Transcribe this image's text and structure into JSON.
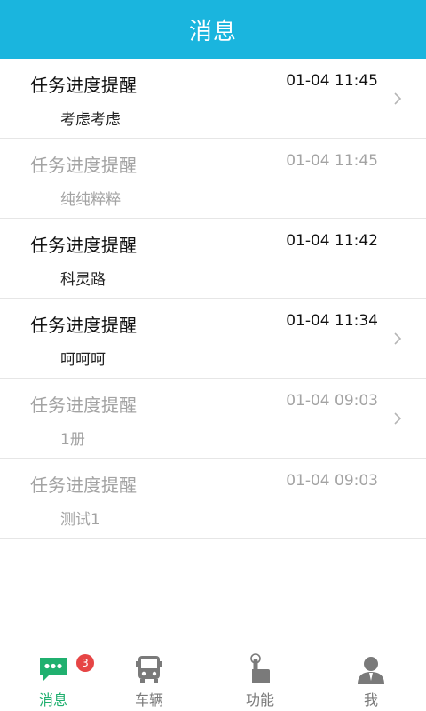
{
  "header": {
    "title": "消息"
  },
  "messages": [
    {
      "title": "任务进度提醒",
      "time": "01-04 11:45",
      "body": "考虑考虑",
      "read": false,
      "chevron": true
    },
    {
      "title": "任务进度提醒",
      "time": "01-04 11:45",
      "body": "纯纯粹粹",
      "read": true,
      "chevron": false
    },
    {
      "title": "任务进度提醒",
      "time": "01-04 11:42",
      "body": "科灵路",
      "read": false,
      "chevron": false
    },
    {
      "title": "任务进度提醒",
      "time": "01-04 11:34",
      "body": "呵呵呵",
      "read": false,
      "chevron": true
    },
    {
      "title": "任务进度提醒",
      "time": "01-04 09:03",
      "body": "1册",
      "read": true,
      "chevron": true
    },
    {
      "title": "任务进度提醒",
      "time": "01-04 09:03",
      "body": "测试1",
      "read": true,
      "chevron": false
    }
  ],
  "tabbar": {
    "tabs": [
      {
        "label": "消息",
        "icon": "chat-bubble-icon",
        "active": true,
        "badge": "3"
      },
      {
        "label": "车辆",
        "icon": "bus-icon",
        "active": false
      },
      {
        "label": "功能",
        "icon": "pointing-hand-icon",
        "active": false
      },
      {
        "label": "我",
        "icon": "person-icon",
        "active": false
      }
    ]
  },
  "colors": {
    "header_bg": "#1ab5de",
    "active_tab": "#20b06f",
    "inactive_tab": "#7a7a7a",
    "read_text": "#a3a3a3",
    "badge": "#e64545"
  }
}
